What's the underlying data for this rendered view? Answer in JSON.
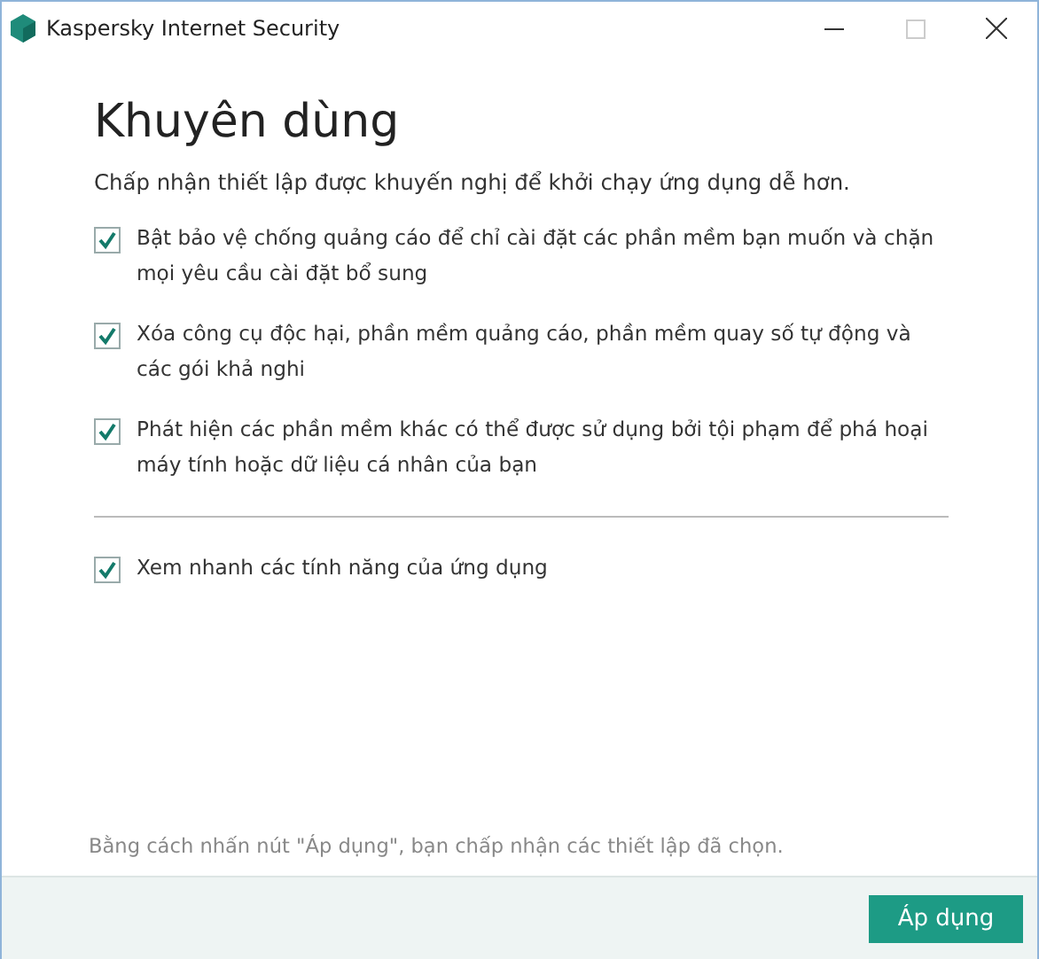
{
  "window": {
    "title": "Kaspersky Internet Security"
  },
  "heading": "Khuyên dùng",
  "subtitle": "Chấp nhận thiết lập được khuyến nghị để khởi chạy ứng dụng dễ hơn.",
  "options": [
    {
      "label": "Bật bảo vệ chống quảng cáo để chỉ cài đặt các phần mềm bạn muốn và chặn mọi yêu cầu cài đặt bổ sung",
      "checked": true
    },
    {
      "label": "Xóa công cụ độc hại, phần mềm quảng cáo, phần mềm quay số tự động và các gói khả nghi",
      "checked": true
    },
    {
      "label": "Phát hiện các phần mềm khác có thể được sử dụng bởi tội phạm để phá hoại máy tính hoặc dữ liệu cá nhân của bạn",
      "checked": true
    }
  ],
  "extra_option": {
    "label": "Xem nhanh các tính năng của ứng dụng",
    "checked": true
  },
  "footer_note": "Bằng cách nhấn nút \"Áp dụng\", bạn chấp nhận các thiết lập đã chọn.",
  "apply_button": "Áp dụng"
}
